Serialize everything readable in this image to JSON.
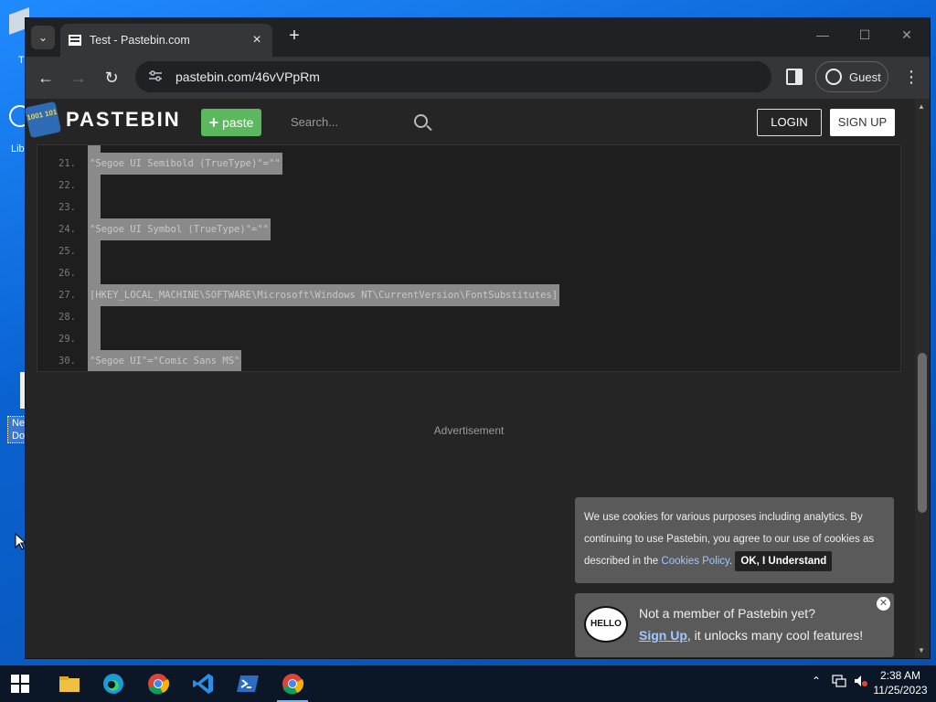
{
  "desktop": {
    "icon_labels": [
      "Th",
      "Lib"
    ],
    "file_label_lines": [
      "Ne",
      "Do"
    ]
  },
  "browser": {
    "tab_title": "Test - Pastebin.com",
    "url": "pastebin.com/46vVPpRm",
    "profile_label": "Guest",
    "new_tab_glyph": "+",
    "close_glyph": "×",
    "min_glyph": "—",
    "max_glyph": "☐",
    "window_close_glyph": "✕",
    "back_glyph": "←",
    "forward_glyph": "→",
    "reload_glyph": "↻",
    "kebab_glyph": "⋮",
    "tab_menu_glyph": "⌄"
  },
  "pastebin": {
    "logo_text": "PASTEBIN",
    "logo_mark": "1001 101",
    "paste_button": "paste",
    "search_placeholder": "Search...",
    "login": "LOGIN",
    "signup": "SIGN UP",
    "code_lines": [
      {
        "num": "21.",
        "text": "\"Segoe UI Semibold (TrueType)\"=\"\""
      },
      {
        "num": "22.",
        "text": ""
      },
      {
        "num": "23.",
        "text": ""
      },
      {
        "num": "24.",
        "text": "\"Segoe UI Symbol (TrueType)\"=\"\""
      },
      {
        "num": "25.",
        "text": ""
      },
      {
        "num": "26.",
        "text": ""
      },
      {
        "num": "27.",
        "text": "[HKEY_LOCAL_MACHINE\\SOFTWARE\\Microsoft\\Windows NT\\CurrentVersion\\FontSubstitutes]"
      },
      {
        "num": "28.",
        "text": ""
      },
      {
        "num": "29.",
        "text": ""
      },
      {
        "num": "30.",
        "text": "\"Segoe UI\"=\"Comic Sans MS\""
      }
    ],
    "advertisement": "Advertisement",
    "cookie": {
      "text_before": "We use cookies for various purposes including analytics. By continuing to use Pastebin, you agree to our use of cookies as described in the ",
      "link": "Cookies Policy",
      "text_after": ". ",
      "button": "OK, I Understand"
    },
    "member": {
      "hello": "HELLO",
      "line1": "Not a member of Pastebin yet?",
      "link": "Sign Up",
      "line2_rest": ", it unlocks many cool features!",
      "close_glyph": "✕"
    }
  },
  "taskbar": {
    "time": "2:38 AM",
    "date": "11/25/2023"
  }
}
